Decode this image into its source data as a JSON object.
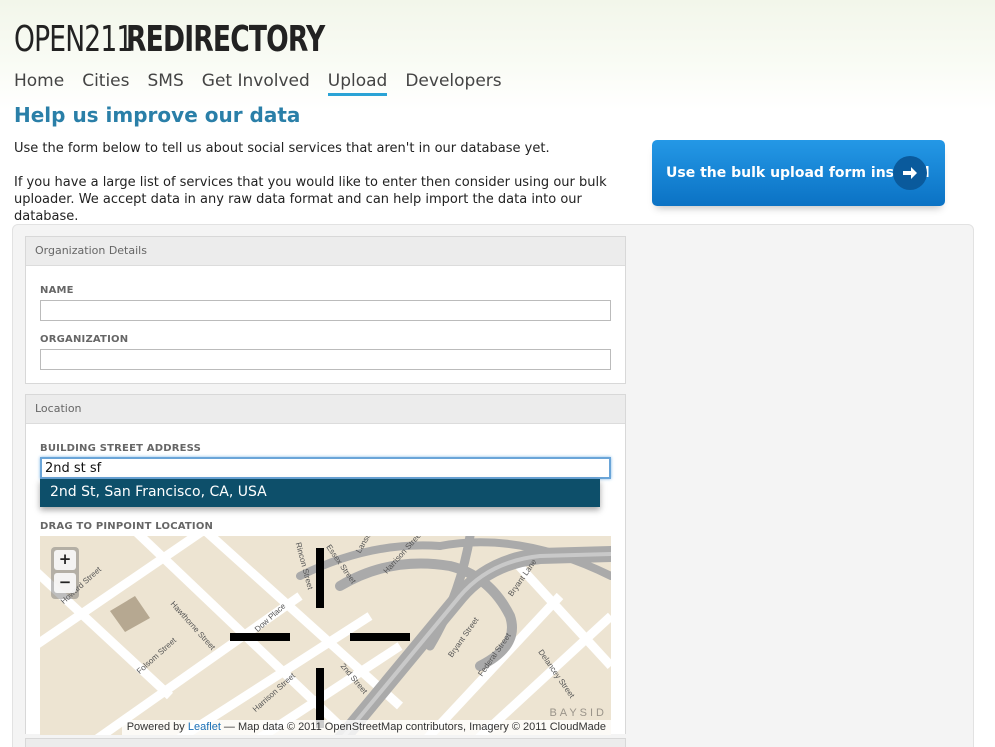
{
  "logo": {
    "part1": "OPEN211",
    "part2": "REDIRECTORY"
  },
  "nav": {
    "items": [
      {
        "label": "Home"
      },
      {
        "label": "Cities"
      },
      {
        "label": "SMS"
      },
      {
        "label": "Get Involved"
      },
      {
        "label": "Upload",
        "active": true
      },
      {
        "label": "Developers"
      }
    ]
  },
  "page": {
    "title": "Help us improve our data",
    "intro_1": "Use the form below to tell us about social services that aren't in our database yet.",
    "intro_2": "If you have a large list of services that you would like to enter then consider using our bulk uploader. We accept data in any raw data format and can help import the data into our database."
  },
  "bulk_button": {
    "label": "Use the bulk upload form instead",
    "icon": "arrow-right-icon"
  },
  "org_section": {
    "legend": "Organization Details",
    "name_label": "NAME",
    "name_value": "",
    "org_label": "ORGANIZATION",
    "org_value": ""
  },
  "location_section": {
    "legend": "Location",
    "address_label": "BUILDING STREET ADDRESS",
    "address_value": "2nd st sf",
    "suggestion": "2nd St, San Francisco, CA, USA",
    "map_label": "DRAG TO PINPOINT LOCATION"
  },
  "map": {
    "zoom_in": "+",
    "zoom_out": "−",
    "attribution_prefix": "Powered by ",
    "attribution_link": "Leaflet",
    "attribution_suffix": " — Map data © 2011 OpenStreetMap contributors, Imagery © 2011 CloudMade",
    "watermark": "BAYSID",
    "streets": [
      "Howard Street",
      "Hawthorne Street",
      "Dow Place",
      "Folsom Street",
      "Harrison Street",
      "2nd Street",
      "Bryant Street",
      "Federal Street",
      "Delancey Street",
      "Bryant Lane",
      "Harrison Street",
      "Essex Street",
      "Lansing",
      "Rincon Street"
    ]
  },
  "colors": {
    "accent": "#2a7fa8",
    "nav_underline": "#2aa3d6",
    "button_blue": "#0b72c4",
    "suggest_bg": "#0d4f6a"
  }
}
